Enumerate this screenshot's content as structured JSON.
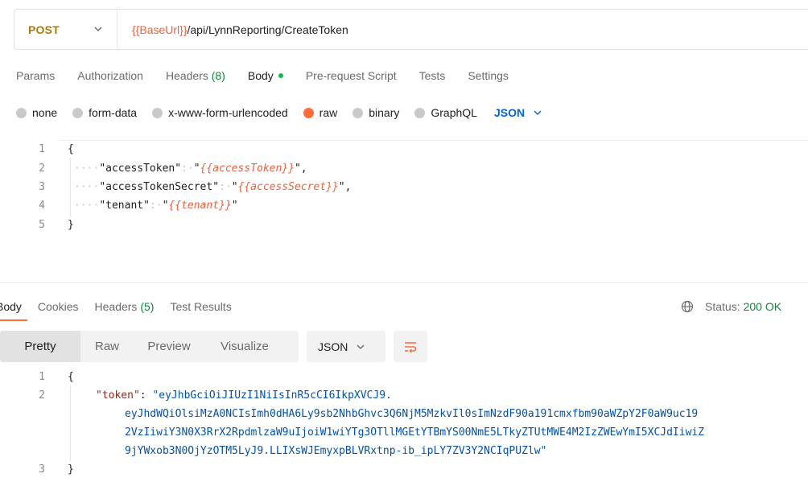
{
  "request": {
    "method": "POST",
    "url_var": "{{BaseUrl}}",
    "url_path": "/api/LynnReporting/CreateToken"
  },
  "request_tabs": {
    "params": "Params",
    "authorization": "Authorization",
    "headers": "Headers",
    "headers_count": "(8)",
    "body": "Body",
    "prerequest": "Pre-request Script",
    "tests": "Tests",
    "settings": "Settings"
  },
  "body_types": {
    "none": "none",
    "form_data": "form-data",
    "urlencoded": "x-www-form-urlencoded",
    "raw": "raw",
    "binary": "binary",
    "graphql": "GraphQL",
    "selected": "raw",
    "language": "JSON"
  },
  "request_body": {
    "line_numbers": [
      "1",
      "2",
      "3",
      "4",
      "5"
    ],
    "open_brace": "{",
    "close_brace": "}",
    "indent": "····",
    "lines": [
      {
        "key": "\"accessToken\"",
        "sep": ":·",
        "value": "{{accessToken}}",
        "trail": ","
      },
      {
        "key": "\"accessTokenSecret\"",
        "sep": ":·",
        "value": "{{accessSecret}}",
        "trail": ","
      },
      {
        "key": "\"tenant\"",
        "sep": ":·",
        "value": "{{tenant}}",
        "trail": ""
      }
    ]
  },
  "response_tabs": {
    "body": "Body",
    "cookies": "Cookies",
    "headers": "Headers",
    "headers_count": "(5)",
    "test_results": "Test Results"
  },
  "status": {
    "label": "Status:",
    "value": "200 OK"
  },
  "response_view": {
    "pretty": "Pretty",
    "raw": "Raw",
    "preview": "Preview",
    "visualize": "Visualize",
    "format": "JSON"
  },
  "response_body": {
    "line_numbers": [
      "1",
      "2",
      "3"
    ],
    "open_brace": "{",
    "close_brace": "}",
    "token_key": "\"token\"",
    "token_lines": [
      "\"eyJhbGciOiJIUzI1NiIsInR5cCI6IkpXVCJ9.",
      "eyJhdWQiOlsiMzA0NCIsImh0dHA6Ly9sb2NhbGhvc3Q6NjM5MzkvIl0sImNzdF90a191cmxfbm90aWZpY2F0aW9uc19",
      "2VzIiwiY3N0X3RrX2RpdmlzaW9uIjoiW1wiYTg3OTllMGEtYTBmYS00NmE5LTkyZTUtMWE4M2IzZWEwYmI5XCJdIiwiZ",
      "9jYWxob3N0OjYzOTM5LyJ9.LLIXsWJEmyxpBLVRxtnp-ib_ipLY7ZV3Y2NCIqPUZlw\""
    ]
  }
}
